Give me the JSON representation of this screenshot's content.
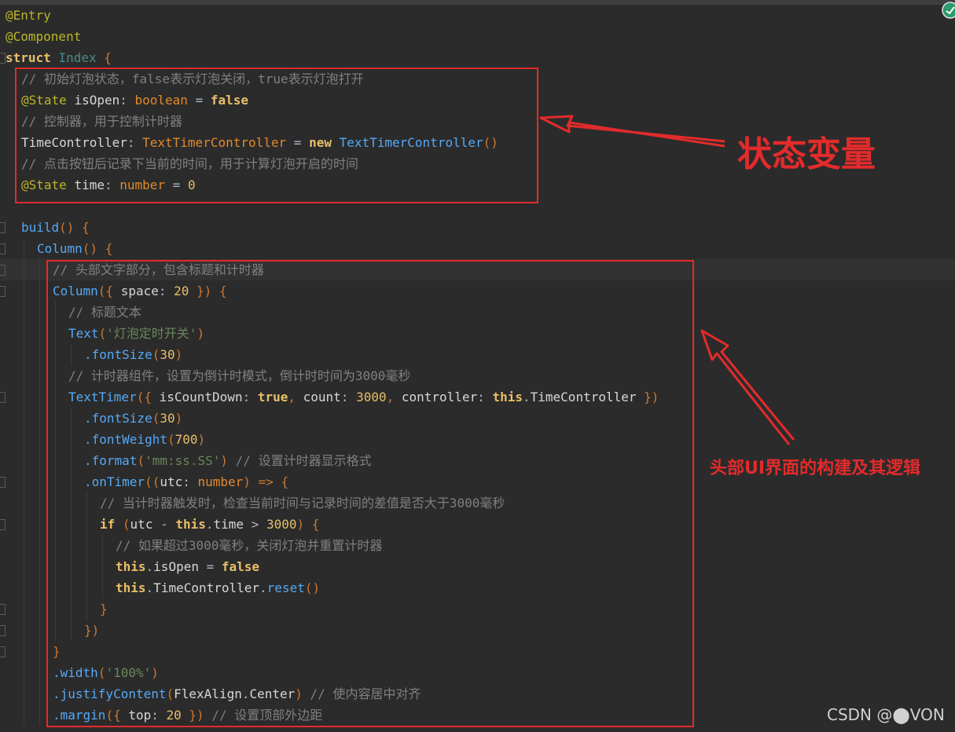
{
  "code_lines": [
    {
      "indent": 0,
      "tokens": [
        {
          "t": "@Entry",
          "c": "ann"
        }
      ]
    },
    {
      "indent": 0,
      "tokens": [
        {
          "t": "@Component",
          "c": "ann"
        }
      ]
    },
    {
      "indent": 0,
      "tokens": [
        {
          "t": "struct ",
          "c": "kwy"
        },
        {
          "t": "Index ",
          "c": "cls"
        },
        {
          "t": "{",
          "c": "kwo"
        }
      ]
    },
    {
      "indent": 1,
      "tokens": [
        {
          "t": "// 初始灯泡状态，false表示灯泡关闭，true表示灯泡打开",
          "c": "com"
        }
      ]
    },
    {
      "indent": 1,
      "tokens": [
        {
          "t": "@State ",
          "c": "ann"
        },
        {
          "t": "isOpen",
          "c": "wh"
        },
        {
          "t": ": ",
          "c": "idn"
        },
        {
          "t": "boolean",
          "c": "typ"
        },
        {
          "t": " = ",
          "c": "idn"
        },
        {
          "t": "false",
          "c": "kwy"
        }
      ]
    },
    {
      "indent": 1,
      "tokens": [
        {
          "t": "// 控制器，用于控制计时器",
          "c": "com"
        }
      ]
    },
    {
      "indent": 1,
      "tokens": [
        {
          "t": "TimeController",
          "c": "wh"
        },
        {
          "t": ": ",
          "c": "idn"
        },
        {
          "t": "TextTimerController",
          "c": "typ"
        },
        {
          "t": " = ",
          "c": "idn"
        },
        {
          "t": "new ",
          "c": "kwy"
        },
        {
          "t": "TextTimerController",
          "c": "typ2"
        },
        {
          "t": "()",
          "c": "kwo"
        }
      ]
    },
    {
      "indent": 1,
      "tokens": [
        {
          "t": "// 点击按钮后记录下当前的时间，用于计算灯泡开启的时间",
          "c": "com"
        }
      ]
    },
    {
      "indent": 1,
      "tokens": [
        {
          "t": "@State ",
          "c": "ann"
        },
        {
          "t": "time",
          "c": "wh"
        },
        {
          "t": ": ",
          "c": "idn"
        },
        {
          "t": "number",
          "c": "typ"
        },
        {
          "t": " = ",
          "c": "idn"
        },
        {
          "t": "0",
          "c": "num2"
        }
      ]
    },
    {
      "indent": 0,
      "tokens": []
    },
    {
      "indent": 1,
      "tokens": [
        {
          "t": "build",
          "c": "fn"
        },
        {
          "t": "() ",
          "c": "kwo"
        },
        {
          "t": "{",
          "c": "kwo"
        }
      ]
    },
    {
      "indent": 2,
      "tokens": [
        {
          "t": "Column",
          "c": "fn"
        },
        {
          "t": "() ",
          "c": "kwo"
        },
        {
          "t": "{",
          "c": "kwo"
        }
      ]
    },
    {
      "indent": 3,
      "hl": true,
      "tokens": [
        {
          "t": "// 头部文字部分，包含标题和计时器",
          "c": "com"
        }
      ]
    },
    {
      "indent": 3,
      "tokens": [
        {
          "t": "Column",
          "c": "fn"
        },
        {
          "t": "({ ",
          "c": "kwo"
        },
        {
          "t": "space",
          "c": "wh"
        },
        {
          "t": ": ",
          "c": "idn"
        },
        {
          "t": "20",
          "c": "num2"
        },
        {
          "t": " }) {",
          "c": "kwo"
        }
      ]
    },
    {
      "indent": 4,
      "tokens": [
        {
          "t": "// 标题文本",
          "c": "com"
        }
      ]
    },
    {
      "indent": 4,
      "tokens": [
        {
          "t": "Text",
          "c": "fn"
        },
        {
          "t": "(",
          "c": "kwo"
        },
        {
          "t": "'灯泡定时开关'",
          "c": "str"
        },
        {
          "t": ")",
          "c": "kwo"
        }
      ]
    },
    {
      "indent": 5,
      "tokens": [
        {
          "t": ".fontSize",
          "c": "fn"
        },
        {
          "t": "(",
          "c": "kwo"
        },
        {
          "t": "30",
          "c": "num2"
        },
        {
          "t": ")",
          "c": "kwo"
        }
      ]
    },
    {
      "indent": 4,
      "tokens": [
        {
          "t": "// 计时器组件，设置为倒计时模式，倒计时时间为3000毫秒",
          "c": "com"
        }
      ]
    },
    {
      "indent": 4,
      "tokens": [
        {
          "t": "TextTimer",
          "c": "fn"
        },
        {
          "t": "({ ",
          "c": "kwo"
        },
        {
          "t": "isCountDown",
          "c": "wh"
        },
        {
          "t": ": ",
          "c": "idn"
        },
        {
          "t": "true",
          "c": "kwy"
        },
        {
          "t": ", ",
          "c": "kwo"
        },
        {
          "t": "count",
          "c": "wh"
        },
        {
          "t": ": ",
          "c": "idn"
        },
        {
          "t": "3000",
          "c": "num2"
        },
        {
          "t": ", ",
          "c": "kwo"
        },
        {
          "t": "controller",
          "c": "wh"
        },
        {
          "t": ": ",
          "c": "idn"
        },
        {
          "t": "this",
          "c": "kwy"
        },
        {
          "t": ".",
          "c": "idn"
        },
        {
          "t": "TimeController",
          "c": "wh"
        },
        {
          "t": " })",
          "c": "kwo"
        }
      ]
    },
    {
      "indent": 5,
      "tokens": [
        {
          "t": ".fontSize",
          "c": "fn"
        },
        {
          "t": "(",
          "c": "kwo"
        },
        {
          "t": "30",
          "c": "num2"
        },
        {
          "t": ")",
          "c": "kwo"
        }
      ]
    },
    {
      "indent": 5,
      "tokens": [
        {
          "t": ".fontWeight",
          "c": "fn"
        },
        {
          "t": "(",
          "c": "kwo"
        },
        {
          "t": "700",
          "c": "num2"
        },
        {
          "t": ")",
          "c": "kwo"
        }
      ]
    },
    {
      "indent": 5,
      "tokens": [
        {
          "t": ".format",
          "c": "fn"
        },
        {
          "t": "(",
          "c": "kwo"
        },
        {
          "t": "'mm:ss.SS'",
          "c": "str"
        },
        {
          "t": ") ",
          "c": "kwo"
        },
        {
          "t": "// 设置计时器显示格式",
          "c": "com"
        }
      ]
    },
    {
      "indent": 5,
      "tokens": [
        {
          "t": ".onTimer",
          "c": "fn"
        },
        {
          "t": "((",
          "c": "kwo"
        },
        {
          "t": "utc",
          "c": "wh"
        },
        {
          "t": ": ",
          "c": "idn"
        },
        {
          "t": "number",
          "c": "typ"
        },
        {
          "t": ") => {",
          "c": "kwo"
        }
      ]
    },
    {
      "indent": 6,
      "tokens": [
        {
          "t": "// 当计时器触发时，检查当前时间与记录时间的差值是否大于3000毫秒",
          "c": "com"
        }
      ]
    },
    {
      "indent": 6,
      "tokens": [
        {
          "t": "if ",
          "c": "kwy"
        },
        {
          "t": "(",
          "c": "kwo"
        },
        {
          "t": "utc",
          "c": "wh"
        },
        {
          "t": " - ",
          "c": "idn"
        },
        {
          "t": "this",
          "c": "kwy"
        },
        {
          "t": ".",
          "c": "idn"
        },
        {
          "t": "time",
          "c": "wh"
        },
        {
          "t": " > ",
          "c": "idn"
        },
        {
          "t": "3000",
          "c": "num2"
        },
        {
          "t": ") {",
          "c": "kwo"
        }
      ]
    },
    {
      "indent": 7,
      "tokens": [
        {
          "t": "// 如果超过3000毫秒，关闭灯泡并重置计时器",
          "c": "com"
        }
      ]
    },
    {
      "indent": 7,
      "tokens": [
        {
          "t": "this",
          "c": "kwy"
        },
        {
          "t": ".",
          "c": "idn"
        },
        {
          "t": "isOpen",
          "c": "wh"
        },
        {
          "t": " = ",
          "c": "idn"
        },
        {
          "t": "false",
          "c": "kwy"
        }
      ]
    },
    {
      "indent": 7,
      "tokens": [
        {
          "t": "this",
          "c": "kwy"
        },
        {
          "t": ".",
          "c": "idn"
        },
        {
          "t": "TimeController",
          "c": "wh"
        },
        {
          "t": ".",
          "c": "idn"
        },
        {
          "t": "reset",
          "c": "fn"
        },
        {
          "t": "()",
          "c": "kwo"
        }
      ]
    },
    {
      "indent": 6,
      "tokens": [
        {
          "t": "}",
          "c": "kwo"
        }
      ]
    },
    {
      "indent": 5,
      "tokens": [
        {
          "t": "})",
          "c": "kwo"
        }
      ]
    },
    {
      "indent": 3,
      "tokens": [
        {
          "t": "}",
          "c": "kwo"
        }
      ]
    },
    {
      "indent": 3,
      "tokens": [
        {
          "t": ".width",
          "c": "fn"
        },
        {
          "t": "(",
          "c": "kwo"
        },
        {
          "t": "'100%'",
          "c": "str"
        },
        {
          "t": ")",
          "c": "kwo"
        }
      ]
    },
    {
      "indent": 3,
      "tokens": [
        {
          "t": ".justifyContent",
          "c": "fn"
        },
        {
          "t": "(",
          "c": "kwo"
        },
        {
          "t": "FlexAlign",
          "c": "wh"
        },
        {
          "t": ".",
          "c": "idn"
        },
        {
          "t": "Center",
          "c": "wh"
        },
        {
          "t": ") ",
          "c": "kwo"
        },
        {
          "t": "// 使内容居中对齐",
          "c": "com"
        }
      ]
    },
    {
      "indent": 3,
      "tokens": [
        {
          "t": ".margin",
          "c": "fn"
        },
        {
          "t": "({ ",
          "c": "kwo"
        },
        {
          "t": "top",
          "c": "wh"
        },
        {
          "t": ": ",
          "c": "idn"
        },
        {
          "t": "20",
          "c": "num2"
        },
        {
          "t": " }) ",
          "c": "kwo"
        },
        {
          "t": "// 设置顶部外边距",
          "c": "com"
        }
      ]
    }
  ],
  "annotations": {
    "state_vars_label": "状态变量",
    "header_ui_label": "头部UI界面的构建及其逻辑"
  },
  "watermark": "CSDN @⬤VON",
  "colors": {
    "background": "#2b2b2b",
    "annotation_red": "#e22b2b"
  }
}
